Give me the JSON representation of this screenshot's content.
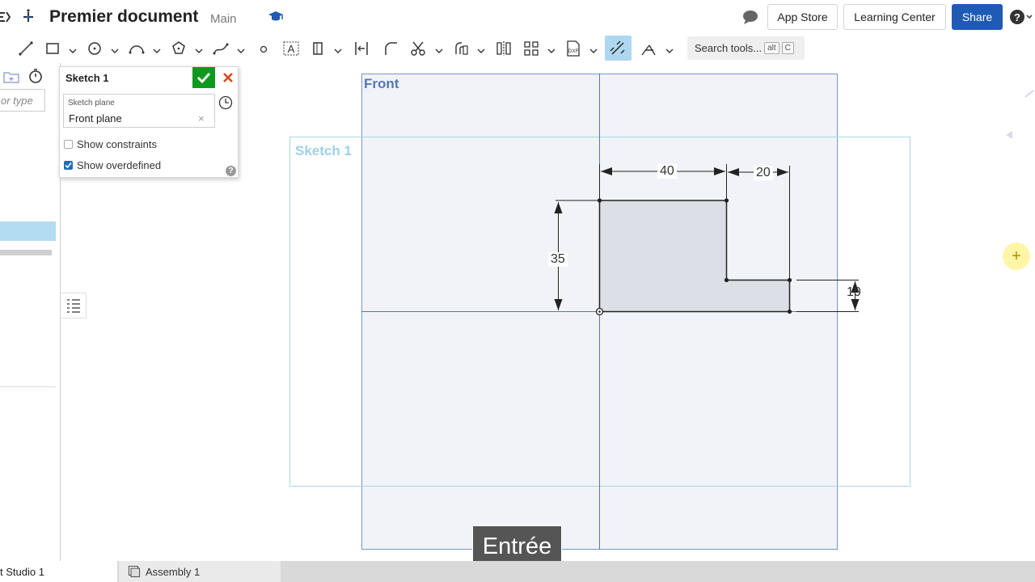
{
  "header": {
    "title": "Premier document",
    "branch": "Main",
    "app_store": "App Store",
    "learning_center": "Learning Center",
    "share": "Share"
  },
  "toolbar": {
    "search_label": "Search tools...",
    "search_shortcut_alt": "alt",
    "search_shortcut_key": "C",
    "tools": [
      "line-tool",
      "rectangle-tool",
      "circle-tool",
      "arc-tool",
      "polygon-tool",
      "spline-tool",
      "point-tool",
      "text-tool",
      "construction-tool",
      "midpoint-tool",
      "fillet-tool",
      "trim-tool",
      "offset-tool",
      "mirror-tool",
      "pattern-tool",
      "dxf-tool",
      "dimension-tool",
      "constraint-tool"
    ]
  },
  "left_panel": {
    "filter_placeholder": "or type"
  },
  "sketch_dialog": {
    "title": "Sketch 1",
    "plane_label": "Sketch plane",
    "plane_value": "Front plane",
    "plane_clear": "×",
    "show_constraints": {
      "label": "Show constraints",
      "checked": false
    },
    "show_overdefined": {
      "label": "Show overdefined",
      "checked": true
    },
    "help": "?"
  },
  "canvas": {
    "plane_label": "Front",
    "sketch_label": "Sketch 1",
    "dimensions": {
      "width_top": "40",
      "width_step": "20",
      "height_left": "35",
      "height_step": "10"
    },
    "keystroke": "Entrée",
    "colors": {
      "plane_fill": "#f1f3f8",
      "plane_stroke": "#5477b6",
      "sketch_frame": "#9fd0ea",
      "profile_fill": "#dcdfe5"
    }
  },
  "bottom_tabs": {
    "part_studio": "t Studio 1",
    "assembly": "Assembly 1"
  }
}
